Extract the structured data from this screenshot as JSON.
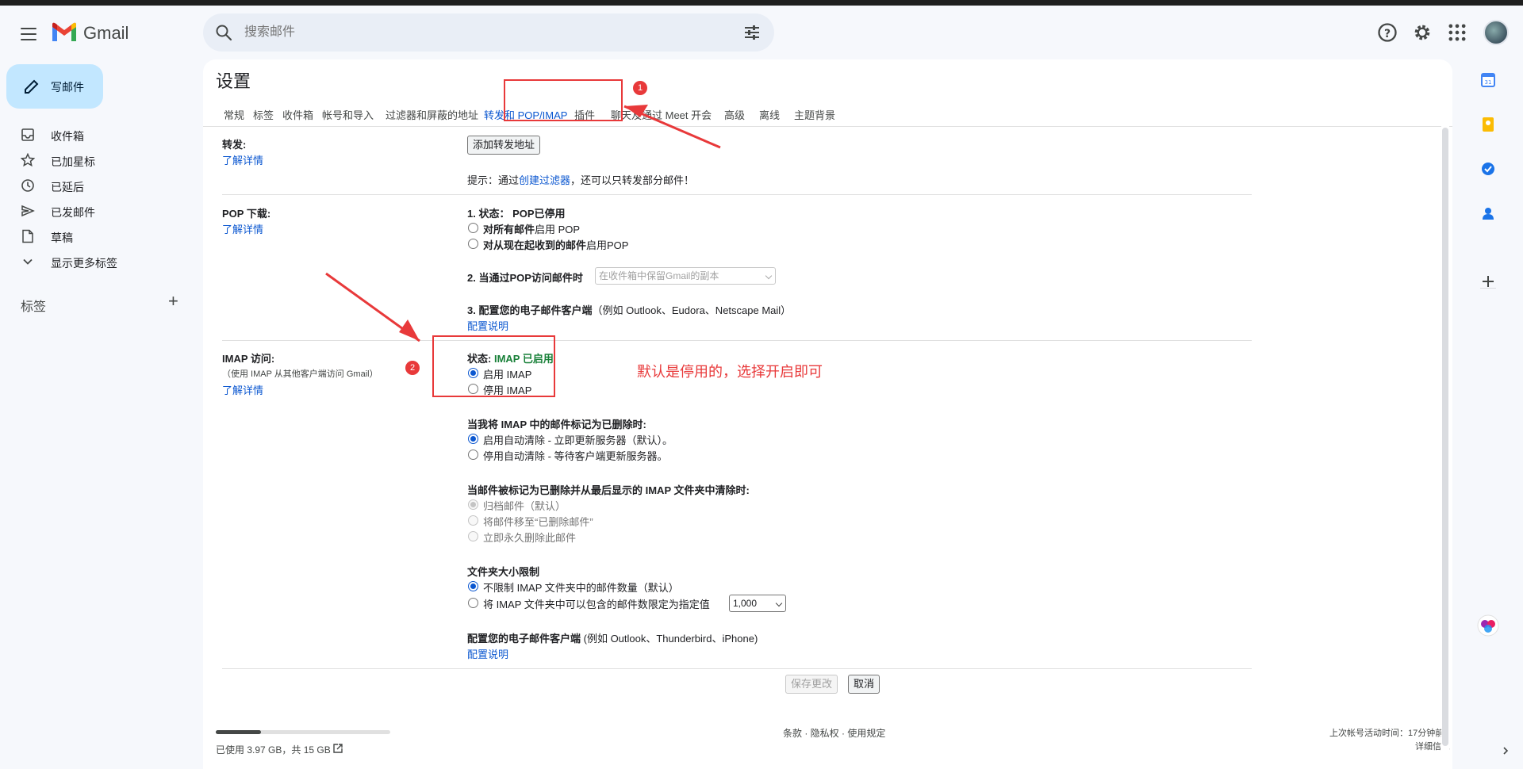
{
  "app": {
    "brand": "Gmail"
  },
  "search": {
    "placeholder": "搜索邮件"
  },
  "nav": {
    "compose": "写邮件",
    "items": [
      {
        "label": "收件箱",
        "icon": "inbox-icon"
      },
      {
        "label": "已加星标",
        "icon": "star-icon"
      },
      {
        "label": "已延后",
        "icon": "clock-icon"
      },
      {
        "label": "已发邮件",
        "icon": "send-icon"
      },
      {
        "label": "草稿",
        "icon": "draft-icon"
      },
      {
        "label": "显示更多标签",
        "icon": "chevron-down-icon"
      }
    ],
    "labels_header": "标签",
    "labels_add": "+"
  },
  "settings": {
    "title": "设置",
    "tabs": [
      "常规",
      "标签",
      "收件箱",
      "帐号和导入",
      "过滤器和屏蔽的地址",
      "转发和 POP/IMAP",
      "插件",
      "聊天及通过 Meet 开会",
      "高级",
      "离线",
      "主题背景"
    ],
    "active_tab": "转发和 POP/IMAP",
    "forwarding": {
      "label": "转发:",
      "learn_more": "了解详情",
      "add_button": "添加转发地址",
      "hint_prefix": "提示：通过",
      "hint_link": "创建过滤器",
      "hint_suffix": "，还可以只转发部分邮件！"
    },
    "pop": {
      "label": "POP 下载:",
      "learn_more": "了解详情",
      "status_heading": "1. 状态： POP已停用",
      "opt1_bold": "对所有邮件",
      "opt1_rest": "启用 POP",
      "opt2_bold": "对从现在起收到的邮件",
      "opt2_rest": "启用POP",
      "access_heading": "2. 当通过POP访问邮件时",
      "access_select": "在收件箱中保留Gmail的副本",
      "client_heading": "3. 配置您的电子邮件客户端",
      "client_examples": "（例如 Outlook、Eudora、Netscape Mail）",
      "config_link": "配置说明"
    },
    "imap": {
      "label": "IMAP 访问:",
      "sublabel": "（使用 IMAP 从其他客户端访问 Gmail）",
      "learn_more": "了解详情",
      "status_prefix": "状态: ",
      "status_value": "IMAP 已启用",
      "enable": "启用 IMAP",
      "disable": "停用 IMAP",
      "deleted_heading": "当我将 IMAP 中的邮件标记为已删除时:",
      "auto_expunge_on": "启用自动清除 - 立即更新服务器（默认）。",
      "auto_expunge_off": "停用自动清除 - 等待客户端更新服务器。",
      "expunged_heading": "当邮件被标记为已删除并从最后显示的 IMAP 文件夹中清除时:",
      "archive": "归档邮件（默认）",
      "move_trash": "将邮件移至“已删除邮件”",
      "delete_forever": "立即永久删除此邮件",
      "folder_heading": "文件夹大小限制",
      "no_limit": "不限制 IMAP 文件夹中的邮件数量（默认）",
      "limit": "将 IMAP 文件夹中可以包含的邮件数限定为指定值",
      "limit_value": "1,000",
      "client_heading": "配置您的电子邮件客户端",
      "client_examples": " (例如 Outlook、Thunderbird、iPhone)",
      "config_link": "配置说明"
    },
    "save_button": "保存更改",
    "cancel_button": "取消"
  },
  "annotations": {
    "badge1": "1",
    "badge2": "2",
    "note": "默认是停用的，选择开启即可",
    "color": "#e8393a"
  },
  "footer": {
    "storage": "已使用 3.97 GB，共 15 GB",
    "storage_fraction": 0.26,
    "links": "条款 · 隐私权 · 使用规定",
    "last_activity": "上次帐号活动时间：17分钟前",
    "details": "详细信息"
  },
  "colors": {
    "accent": "#0b57d0",
    "compose_bg": "#c2e7ff",
    "imap_enabled": "#188038"
  }
}
